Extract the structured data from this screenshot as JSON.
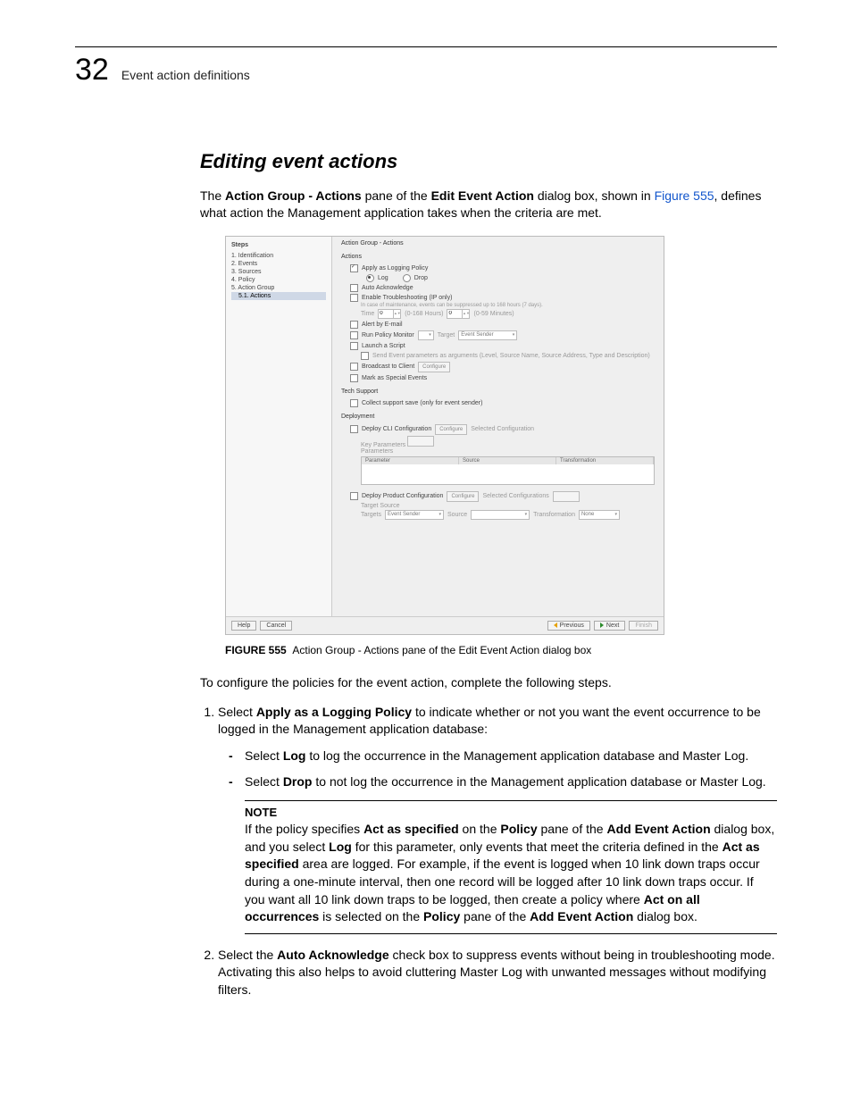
{
  "header": {
    "chapter_no": "32",
    "chapter_title": "Event action definitions"
  },
  "section": {
    "title": "Editing event actions"
  },
  "intro": {
    "pre": "The ",
    "b1": "Action Group - Actions",
    "mid1": " pane of the ",
    "b2": "Edit Event Action",
    "mid2": " dialog box, shown in ",
    "link": "Figure 555",
    "post": ", defines what action the Management application takes when the criteria are met."
  },
  "dialog": {
    "steps_title": "Steps",
    "steps": [
      "1. Identification",
      "2. Events",
      "3. Sources",
      "4. Policy",
      "5. Action Group",
      "5.1. Actions"
    ],
    "panel_title": "Action Group - Actions",
    "actions_heading": "Actions",
    "apply_logging": "Apply as Logging Policy",
    "log": "Log",
    "drop": "Drop",
    "auto_ack": "Auto Acknowledge",
    "enable_ts": "Enable Troubleshooting (IP only)",
    "ts_hint": "In case of maintenance, events can be suppressed up to 168 hours (7 days).",
    "time_lbl": "Time",
    "time_h_range": "(0-168 Hours)",
    "time_m_range": "(0-59 Minutes)",
    "time_h": "0",
    "time_m": "0",
    "alert_email": "Alert by E-mail",
    "run_policy": "Run Policy Monitor",
    "target_lbl": "Target",
    "target_val": "Event Sender",
    "launch_script": "Launch a Script",
    "send_params": "Send Event parameters as arguments (Level, Source Name, Source Address, Type and Description)",
    "broadcast": "Broadcast to Client",
    "configure": "Configure",
    "mark_special": "Mark as Special Events",
    "tech_heading": "Tech Support",
    "collect": "Collect support save (only for event sender)",
    "deploy_heading": "Deployment",
    "deploy_cli": "Deploy CLI Configuration",
    "sel_cfg": "Selected Configuration",
    "key_params": "Key Parameters",
    "params": "Parameters",
    "th": {
      "p": "Parameter",
      "s": "Source",
      "t": "Transformation"
    },
    "deploy_prod": "Deploy Product Configuration",
    "sel_cfgs": "Selected Configurations",
    "target_source": "Target Source",
    "targets": "Targets",
    "source": "Source",
    "transformation": "Transformation",
    "none": "None",
    "footer": {
      "help": "Help",
      "cancel": "Cancel",
      "prev": "Previous",
      "next": "Next",
      "finish": "Finish"
    }
  },
  "caption": {
    "label": "FIGURE 555",
    "text": "Action Group - Actions pane of the Edit Event Action dialog box"
  },
  "after_fig": "To configure the policies for the event action, complete the following steps.",
  "step1": {
    "pre": "Select ",
    "b": "Apply as a Logging Policy",
    "post": " to indicate whether or not you want the event occurrence to be logged in the Management application database:",
    "d1a": "Select ",
    "d1b": "Log",
    "d1c": " to log the occurrence in the Management application database and Master Log.",
    "d2a": "Select ",
    "d2b": "Drop",
    "d2c": " to not log the occurrence in the Management application database or Master Log."
  },
  "note": {
    "title": "NOTE",
    "t1": "If the policy specifies ",
    "b1": "Act as specified",
    "t2": " on the ",
    "b2": "Policy",
    "t3": " pane of the ",
    "b3": "Add Event Action",
    "t4": " dialog box, and you select ",
    "b4": "Log",
    "t5": " for this parameter, only events that meet the criteria defined in the ",
    "b5": "Act as specified",
    "t6": " area are logged. For example, if the event is logged when 10 link down traps occur during a one-minute interval, then one record will be logged after 10 link down traps occur. If you want all 10 link down traps to be logged, then create a policy where ",
    "b6": "Act on all occurrences",
    "t7": " is selected on the ",
    "b7": "Policy",
    "t8": " pane of the ",
    "b8": "Add Event Action",
    "t9": " dialog box."
  },
  "step2": {
    "pre": "Select the ",
    "b": "Auto Acknowledge",
    "post": " check box to suppress events without being in troubleshooting mode. Activating this also helps to avoid cluttering Master Log with unwanted messages without modifying filters."
  }
}
